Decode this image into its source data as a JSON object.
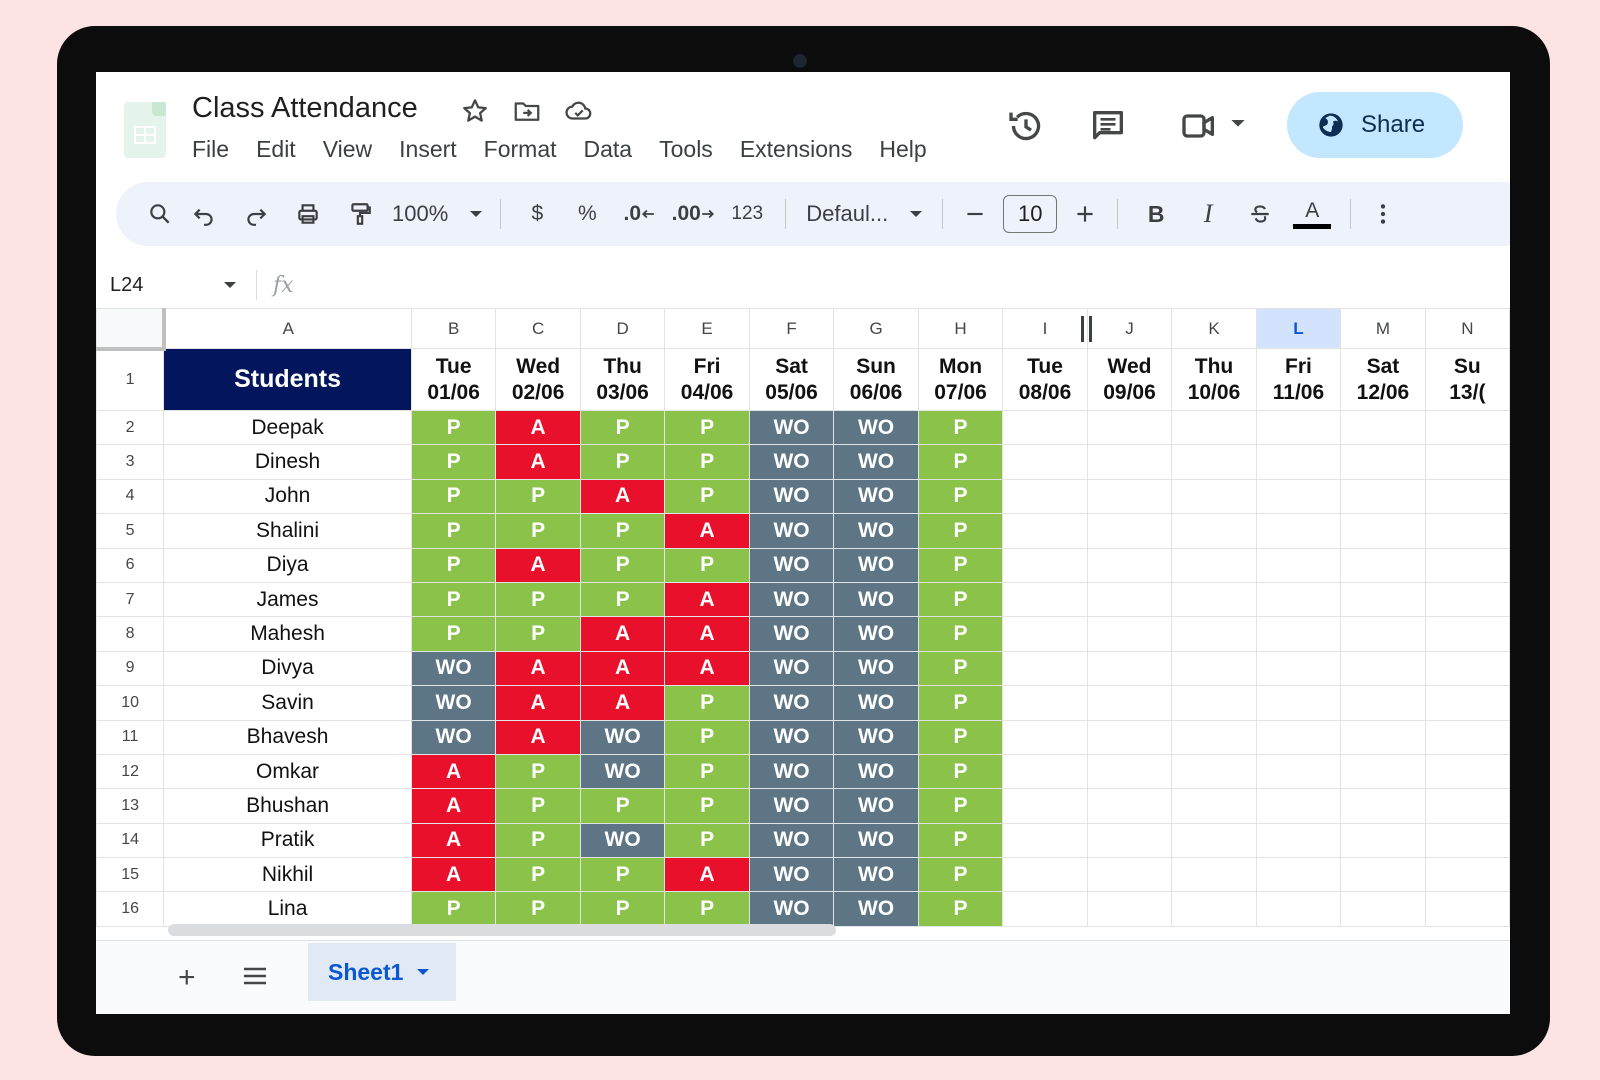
{
  "doc": {
    "title": "Class Attendance"
  },
  "menu": [
    "File",
    "Edit",
    "View",
    "Insert",
    "Format",
    "Data",
    "Tools",
    "Extensions",
    "Help"
  ],
  "share": {
    "label": "Share"
  },
  "toolbar": {
    "zoom": "100%",
    "currency": "$",
    "percent": "%",
    "decrease_decimal": ".0",
    "increase_decimal": ".00",
    "number_format": "123",
    "font": "Defaul...",
    "font_size": "10",
    "bold": "B",
    "italic": "I",
    "text_color_letter": "A"
  },
  "formula_bar": {
    "name_box": "L24",
    "fx": "fx"
  },
  "grid": {
    "selected_column": "L",
    "columns": [
      "A",
      "B",
      "C",
      "D",
      "E",
      "F",
      "G",
      "H",
      "I",
      "J",
      "K",
      "L",
      "M",
      "N"
    ],
    "header_label": "Students",
    "dates": [
      [
        "Tue",
        "01/06"
      ],
      [
        "Wed",
        "02/06"
      ],
      [
        "Thu",
        "03/06"
      ],
      [
        "Fri",
        "04/06"
      ],
      [
        "Sat",
        "05/06"
      ],
      [
        "Sun",
        "06/06"
      ],
      [
        "Mon",
        "07/06"
      ],
      [
        "Tue",
        "08/06"
      ],
      [
        "Wed",
        "09/06"
      ],
      [
        "Thu",
        "10/06"
      ],
      [
        "Fri",
        "11/06"
      ],
      [
        "Sat",
        "12/06"
      ],
      [
        "Su",
        "13/("
      ]
    ],
    "rows": [
      {
        "n": 2,
        "name": "Deepak",
        "s": [
          "P",
          "A",
          "P",
          "P",
          "WO",
          "WO",
          "P"
        ]
      },
      {
        "n": 3,
        "name": "Dinesh",
        "s": [
          "P",
          "A",
          "P",
          "P",
          "WO",
          "WO",
          "P"
        ]
      },
      {
        "n": 4,
        "name": "John",
        "s": [
          "P",
          "P",
          "A",
          "P",
          "WO",
          "WO",
          "P"
        ]
      },
      {
        "n": 5,
        "name": "Shalini",
        "s": [
          "P",
          "P",
          "P",
          "A",
          "WO",
          "WO",
          "P"
        ]
      },
      {
        "n": 6,
        "name": "Diya",
        "s": [
          "P",
          "A",
          "P",
          "P",
          "WO",
          "WO",
          "P"
        ]
      },
      {
        "n": 7,
        "name": "James",
        "s": [
          "P",
          "P",
          "P",
          "A",
          "WO",
          "WO",
          "P"
        ]
      },
      {
        "n": 8,
        "name": "Mahesh",
        "s": [
          "P",
          "P",
          "A",
          "A",
          "WO",
          "WO",
          "P"
        ]
      },
      {
        "n": 9,
        "name": "Divya",
        "s": [
          "WO",
          "A",
          "A",
          "A",
          "WO",
          "WO",
          "P"
        ]
      },
      {
        "n": 10,
        "name": "Savin",
        "s": [
          "WO",
          "A",
          "A",
          "P",
          "WO",
          "WO",
          "P"
        ]
      },
      {
        "n": 11,
        "name": "Bhavesh",
        "s": [
          "WO",
          "A",
          "WO",
          "P",
          "WO",
          "WO",
          "P"
        ]
      },
      {
        "n": 12,
        "name": "Omkar",
        "s": [
          "A",
          "P",
          "WO",
          "P",
          "WO",
          "WO",
          "P"
        ]
      },
      {
        "n": 13,
        "name": "Bhushan",
        "s": [
          "A",
          "P",
          "P",
          "P",
          "WO",
          "WO",
          "P"
        ]
      },
      {
        "n": 14,
        "name": "Pratik",
        "s": [
          "A",
          "P",
          "WO",
          "P",
          "WO",
          "WO",
          "P"
        ]
      },
      {
        "n": 15,
        "name": "Nikhil",
        "s": [
          "A",
          "P",
          "P",
          "A",
          "WO",
          "WO",
          "P"
        ]
      },
      {
        "n": 16,
        "name": "Lina",
        "s": [
          "P",
          "P",
          "P",
          "P",
          "WO",
          "WO",
          "P"
        ]
      }
    ]
  },
  "tabs": {
    "active": "Sheet1"
  },
  "colors": {
    "present": "#8bc34a",
    "absent": "#e8102a",
    "weekly_off": "#5d7584",
    "header_navy": "#03155c",
    "share_bg": "#c2e7ff",
    "accent": "#0b57d0"
  }
}
